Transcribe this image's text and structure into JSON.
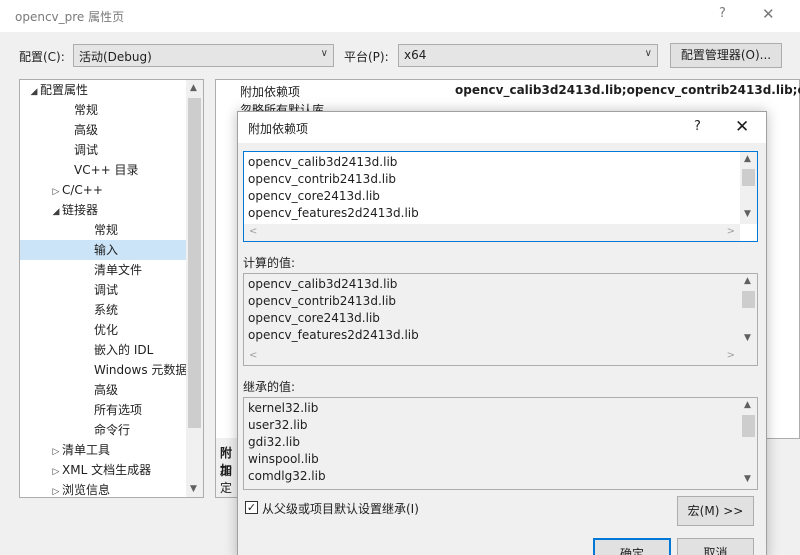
{
  "window": {
    "title": "opencv_pre 属性页",
    "help_glyph": "?",
    "close_glyph": "✕"
  },
  "toolbar": {
    "config_label": "配置(C):",
    "config_value": "活动(Debug)",
    "platform_label": "平台(P):",
    "platform_value": "x64",
    "config_manager_label": "配置管理器(O)..."
  },
  "tree": {
    "items": [
      {
        "label": "配置属性",
        "indent": 0,
        "expander": "◢"
      },
      {
        "label": "常规",
        "indent": 2,
        "expander": ""
      },
      {
        "label": "高级",
        "indent": 2,
        "expander": ""
      },
      {
        "label": "调试",
        "indent": 2,
        "expander": ""
      },
      {
        "label": "VC++ 目录",
        "indent": 2,
        "expander": ""
      },
      {
        "label": "C/C++",
        "indent": 1,
        "expander": "▷"
      },
      {
        "label": "链接器",
        "indent": 1,
        "expander": "◢"
      },
      {
        "label": "常规",
        "indent": 3,
        "expander": ""
      },
      {
        "label": "输入",
        "indent": 3,
        "expander": "",
        "selected": true
      },
      {
        "label": "清单文件",
        "indent": 3,
        "expander": ""
      },
      {
        "label": "调试",
        "indent": 3,
        "expander": ""
      },
      {
        "label": "系统",
        "indent": 3,
        "expander": ""
      },
      {
        "label": "优化",
        "indent": 3,
        "expander": ""
      },
      {
        "label": "嵌入的 IDL",
        "indent": 3,
        "expander": ""
      },
      {
        "label": "Windows 元数据",
        "indent": 3,
        "expander": ""
      },
      {
        "label": "高级",
        "indent": 3,
        "expander": ""
      },
      {
        "label": "所有选项",
        "indent": 3,
        "expander": ""
      },
      {
        "label": "命令行",
        "indent": 3,
        "expander": ""
      },
      {
        "label": "清单工具",
        "indent": 1,
        "expander": "▷"
      },
      {
        "label": "XML 文档生成器",
        "indent": 1,
        "expander": "▷"
      },
      {
        "label": "浏览信息",
        "indent": 1,
        "expander": "▷"
      }
    ]
  },
  "grid": {
    "rows": [
      {
        "name": "附加依赖项",
        "value": "opencv_calib3d2413d.lib;opencv_contrib2413d.lib;ope"
      },
      {
        "name": "忽略所有默认库",
        "value": ""
      }
    ]
  },
  "description": {
    "title": "附加",
    "text": "指定"
  },
  "dialog": {
    "title": "附加依赖项",
    "help_glyph": "?",
    "close_glyph": "✕",
    "edit_lines": [
      "opencv_calib3d2413d.lib",
      "opencv_contrib2413d.lib",
      "opencv_core2413d.lib",
      "opencv_features2d2413d.lib"
    ],
    "computed_label": "计算的值:",
    "computed_lines": [
      "opencv_calib3d2413d.lib",
      "opencv_contrib2413d.lib",
      "opencv_core2413d.lib",
      "opencv_features2d2413d.lib"
    ],
    "inherited_label": "继承的值:",
    "inherited_lines": [
      "kernel32.lib",
      "user32.lib",
      "gdi32.lib",
      "winspool.lib",
      "comdlg32.lib"
    ],
    "inherit_checkbox_label": "从父级或项目默认设置继承(I)",
    "inherit_checked": true,
    "macro_button_label": "宏(M) >>",
    "ok_label": "确定",
    "cancel_label": "取消"
  }
}
